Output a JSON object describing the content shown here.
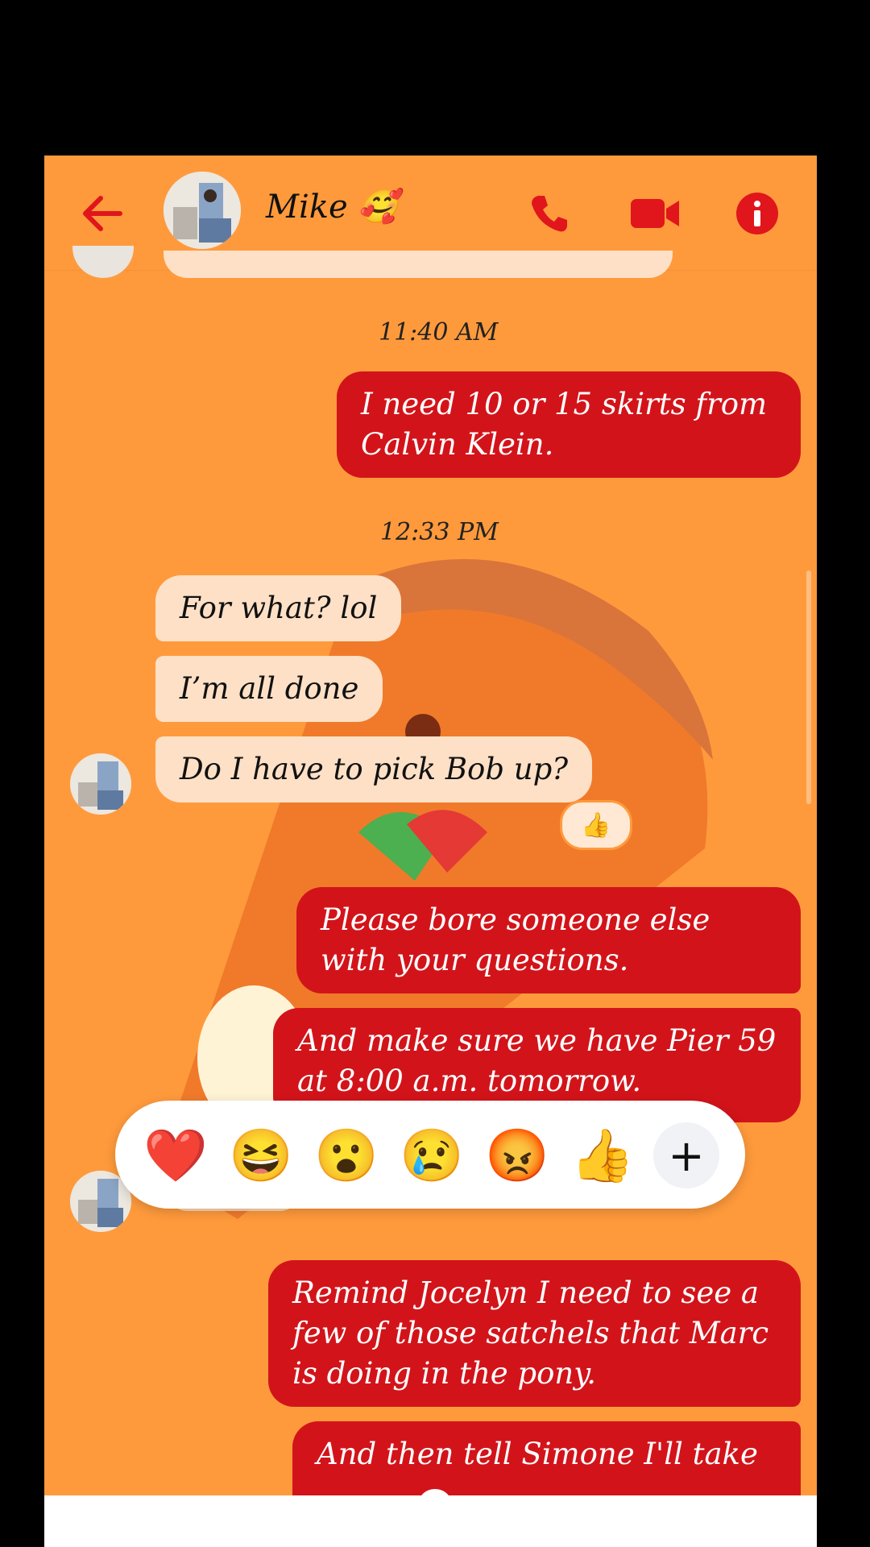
{
  "header": {
    "contact_name": "Mike 🥰",
    "icons": {
      "back": "arrow-left-icon",
      "call": "phone-icon",
      "video": "video-camera-icon",
      "info": "info-icon"
    },
    "accent_color": "#e0161c"
  },
  "messages": {
    "timestamp1": "11:40 AM",
    "msg1": "I need 10 or 15 skirts from Calvin Klein.",
    "timestamp2": "12:33 PM",
    "msg2": "For what? lol",
    "msg3": "I’m all done",
    "msg4": "Do I have to pick Bob up?",
    "msg4_reaction": "👍",
    "msg5": "Please bore someone else with your questions.",
    "msg6": "And make sure we have Pier 59 at 8:00 a.m. tomorrow.",
    "msg7": "Remind Jocelyn I need to see a few of those satchels that Marc is doing in the pony.",
    "msg8": "And then tell Simone I'll take"
  },
  "reaction_bar": {
    "emojis": [
      "❤️",
      "😆",
      "😮",
      "😢",
      "😡",
      "👍"
    ],
    "more": "+"
  },
  "colors": {
    "background": "#ff9a3c",
    "outgoing_bubble": "#d2141a",
    "incoming_bubble": "#fde0c6"
  }
}
